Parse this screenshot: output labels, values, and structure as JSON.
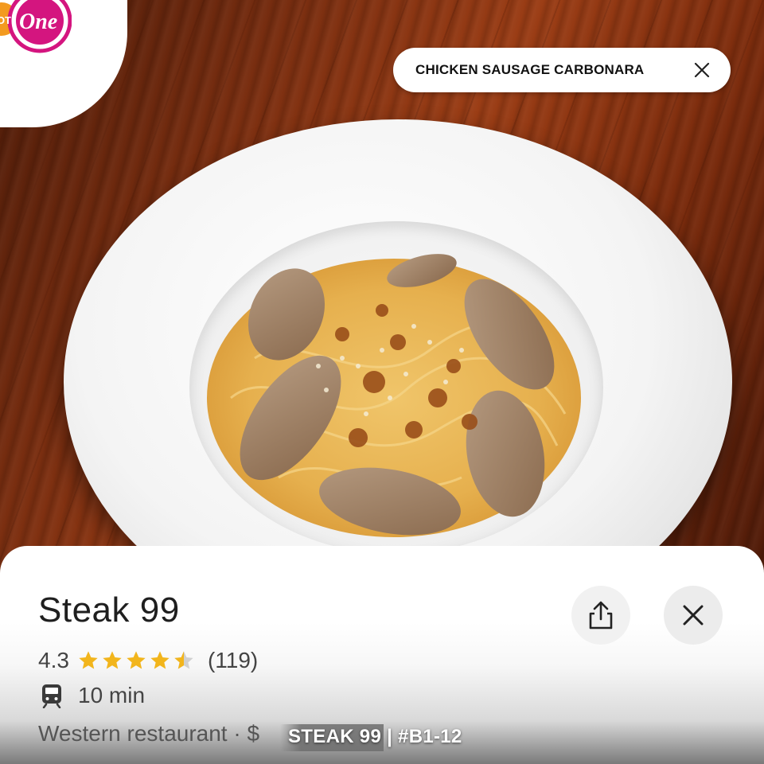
{
  "brand": {
    "logo_text_lot": "LOT",
    "logo_text_one": "One"
  },
  "dish_chip": {
    "label": "CHICKEN SAUSAGE CARBONARA",
    "close_icon": "close-icon"
  },
  "place": {
    "name": "Steak 99",
    "rating": "4.3",
    "rating_value": 4.3,
    "review_count": "(119)",
    "travel_time": "10 min",
    "travel_mode_icon": "train-icon",
    "category": "Western restaurant · $"
  },
  "caption": "STEAK 99 | #B1-12",
  "colors": {
    "star": "#f2b51c",
    "star_empty": "#d0d0d0",
    "logo_orange": "#f39a1f",
    "logo_magenta": "#d4157f"
  }
}
